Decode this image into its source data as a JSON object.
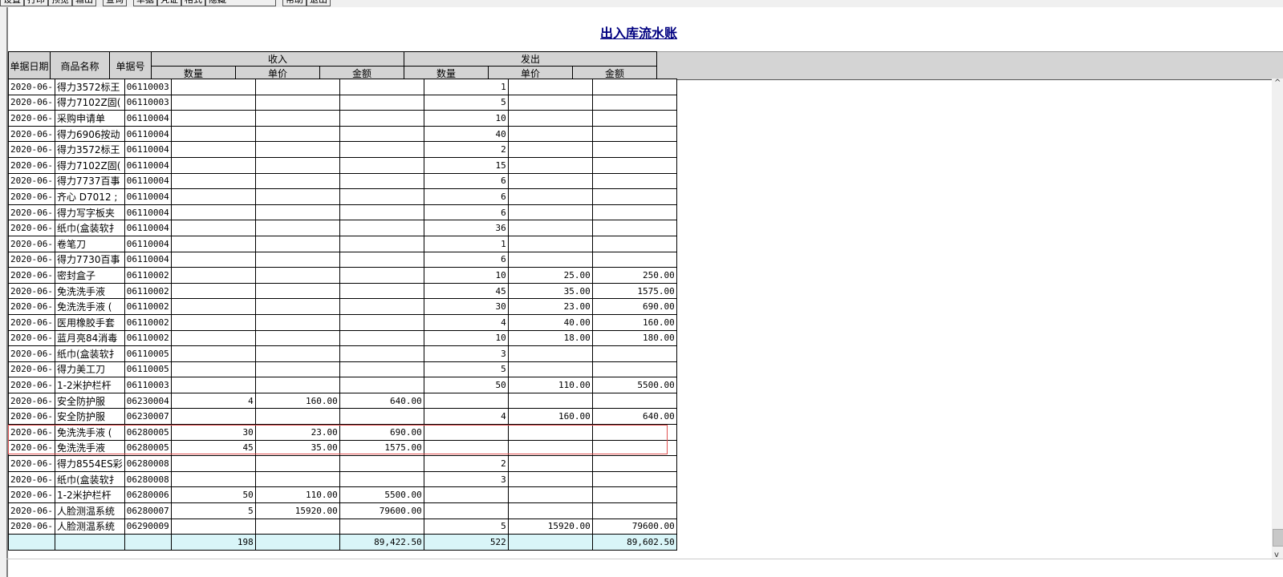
{
  "toolbar": {
    "buttons": [
      "设置",
      "打印",
      "预览",
      "输出",
      "查询",
      "单据",
      "凭证",
      "格式",
      "隐藏",
      "帮助",
      "退出"
    ]
  },
  "report": {
    "title": "出入库流水账"
  },
  "headers": {
    "date": "单据日期",
    "name": "商品名称",
    "doc": "单据号",
    "in_group": "收入",
    "out_group": "发出",
    "qty": "数量",
    "price": "单价",
    "amount": "金额"
  },
  "rows": [
    [
      "2020-06-",
      "得力3572标王",
      "06110003",
      "",
      "",
      "",
      "1",
      "",
      ""
    ],
    [
      "2020-06-",
      "得力7102Z固(",
      "06110003",
      "",
      "",
      "",
      "5",
      "",
      ""
    ],
    [
      "2020-06-",
      "采购申请单",
      "06110004",
      "",
      "",
      "",
      "10",
      "",
      ""
    ],
    [
      "2020-06-",
      "得力6906按动",
      "06110004",
      "",
      "",
      "",
      "40",
      "",
      ""
    ],
    [
      "2020-06-",
      "得力3572标王",
      "06110004",
      "",
      "",
      "",
      "2",
      "",
      ""
    ],
    [
      "2020-06-",
      "得力7102Z固(",
      "06110004",
      "",
      "",
      "",
      "15",
      "",
      ""
    ],
    [
      "2020-06-",
      "得力7737百事",
      "06110004",
      "",
      "",
      "",
      "6",
      "",
      ""
    ],
    [
      "2020-06-",
      "齐心 D7012 ;",
      "06110004",
      "",
      "",
      "",
      "6",
      "",
      ""
    ],
    [
      "2020-06-",
      "得力写字板夹",
      "06110004",
      "",
      "",
      "",
      "6",
      "",
      ""
    ],
    [
      "2020-06-",
      "纸巾(盒装软扌",
      "06110004",
      "",
      "",
      "",
      "36",
      "",
      ""
    ],
    [
      "2020-06-",
      "卷笔刀",
      "06110004",
      "",
      "",
      "",
      "1",
      "",
      ""
    ],
    [
      "2020-06-",
      "得力7730百事",
      "06110004",
      "",
      "",
      "",
      "6",
      "",
      ""
    ],
    [
      "2020-06-",
      "密封盒子",
      "06110002",
      "",
      "",
      "",
      "10",
      "25.00",
      "250.00"
    ],
    [
      "2020-06-",
      "免洗洗手液",
      "06110002",
      "",
      "",
      "",
      "45",
      "35.00",
      "1575.00"
    ],
    [
      "2020-06-",
      "免洗洗手液 (",
      "06110002",
      "",
      "",
      "",
      "30",
      "23.00",
      "690.00"
    ],
    [
      "2020-06-",
      "医用橡胶手套",
      "06110002",
      "",
      "",
      "",
      "4",
      "40.00",
      "160.00"
    ],
    [
      "2020-06-",
      "蓝月亮84消毒",
      "06110002",
      "",
      "",
      "",
      "10",
      "18.00",
      "180.00"
    ],
    [
      "2020-06-",
      "纸巾(盒装软扌",
      "06110005",
      "",
      "",
      "",
      "3",
      "",
      ""
    ],
    [
      "2020-06-",
      "得力美工刀",
      "06110005",
      "",
      "",
      "",
      "5",
      "",
      ""
    ],
    [
      "2020-06-",
      "1-2米护栏杆",
      "06110003",
      "",
      "",
      "",
      "50",
      "110.00",
      "5500.00"
    ],
    [
      "2020-06-",
      "安全防护服",
      "06230004",
      "4",
      "160.00",
      "640.00",
      "",
      "",
      ""
    ],
    [
      "2020-06-",
      "安全防护服",
      "06230007",
      "",
      "",
      "",
      "4",
      "160.00",
      "640.00"
    ],
    [
      "2020-06-",
      "免洗洗手液 (",
      "06280005",
      "30",
      "23.00",
      "690.00",
      "",
      "",
      ""
    ],
    [
      "2020-06-",
      "免洗洗手液",
      "06280005",
      "45",
      "35.00",
      "1575.00",
      "",
      "",
      ""
    ],
    [
      "2020-06-",
      "得力8554ES彩",
      "06280008",
      "",
      "",
      "",
      "2",
      "",
      ""
    ],
    [
      "2020-06-",
      "纸巾(盒装软扌",
      "06280008",
      "",
      "",
      "",
      "3",
      "",
      ""
    ],
    [
      "2020-06-",
      "1-2米护栏杆",
      "06280006",
      "50",
      "110.00",
      "5500.00",
      "",
      "",
      ""
    ],
    [
      "2020-06-",
      "人脸测温系统",
      "06280007",
      "5",
      "15920.00",
      "79600.00",
      "",
      "",
      ""
    ],
    [
      "2020-06-",
      "人脸测温系统",
      "06290009",
      "",
      "",
      "",
      "5",
      "15920.00",
      "79600.00"
    ]
  ],
  "totals": [
    "",
    "",
    "",
    "198",
    "",
    "89,422.50",
    "522",
    "",
    "89,602.50"
  ],
  "scroll": {
    "up": "^",
    "down": "v"
  }
}
